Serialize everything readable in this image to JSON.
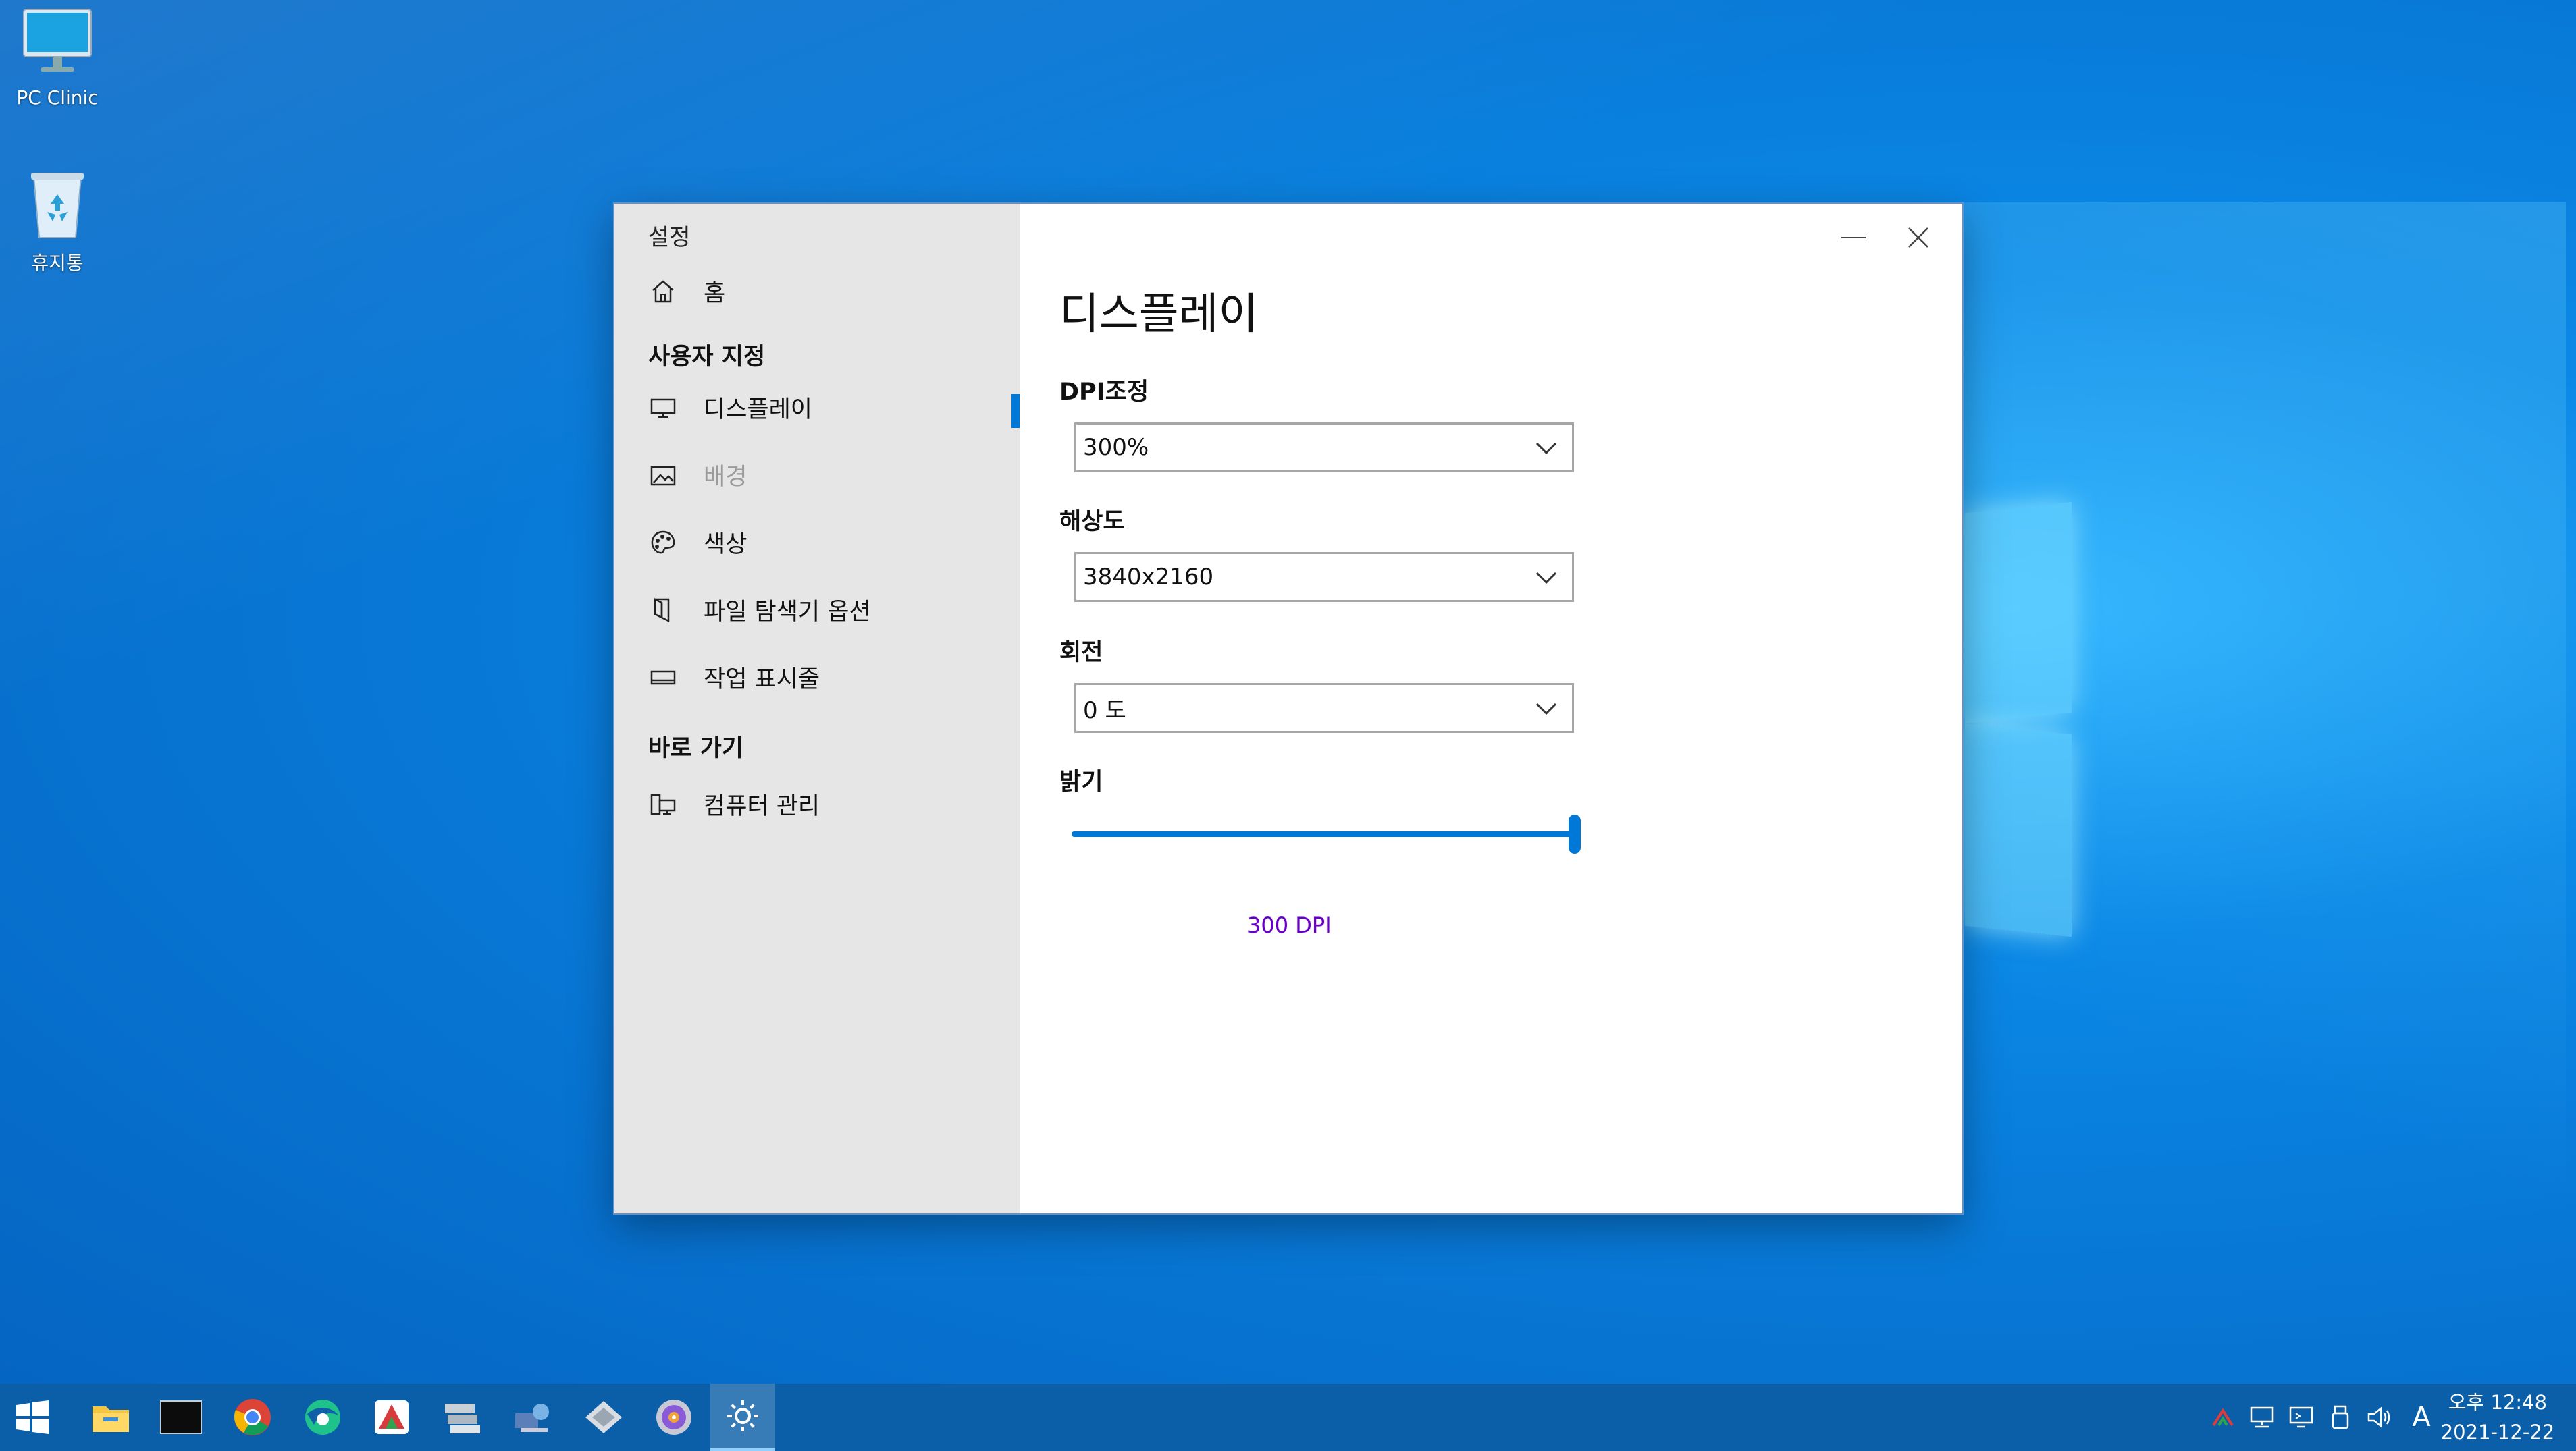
{
  "desktop": {
    "icons": [
      {
        "label": "PC Clinic"
      },
      {
        "label": "휴지통"
      }
    ]
  },
  "window": {
    "app_title": "설정",
    "sidebar": {
      "home": "홈",
      "section_personalize": "사용자 지정",
      "items": [
        {
          "label": "디스플레이",
          "icon": "monitor-icon"
        },
        {
          "label": "배경",
          "icon": "image-icon"
        },
        {
          "label": "색상",
          "icon": "palette-icon"
        },
        {
          "label": "파일 탐색기 옵션",
          "icon": "folder-options-icon"
        },
        {
          "label": "작업 표시줄",
          "icon": "taskbar-icon"
        }
      ],
      "section_shortcuts": "바로 가기",
      "shortcuts": [
        {
          "label": "컴퓨터 관리",
          "icon": "computer-management-icon"
        }
      ]
    },
    "main": {
      "title": "디스플레이",
      "dpi_label": "DPI조정",
      "dpi_value": "300%",
      "resolution_label": "해상도",
      "resolution_value": "3840x2160",
      "rotation_label": "회전",
      "rotation_value": "0 도",
      "brightness_label": "밝기",
      "brightness_level": 1.0,
      "dpi_note": "300 DPI"
    }
  },
  "taskbar": {
    "apps": [
      "start-icon",
      "file-explorer-icon",
      "terminal-icon",
      "chrome-icon",
      "browser-icon",
      "app-icon",
      "drive-tool-icon",
      "network-tool-icon",
      "disk-tool-icon",
      "media-icon",
      "settings-icon"
    ],
    "clock": {
      "period_time": "오후 12:48",
      "date": "2021-12-22"
    },
    "ime": "A"
  },
  "colors": {
    "accent": "#0078d7",
    "sidebar_bg": "#e6e6e6",
    "taskbar_bg": "#0b5ea8",
    "dpi_note": "#6a00c8"
  }
}
